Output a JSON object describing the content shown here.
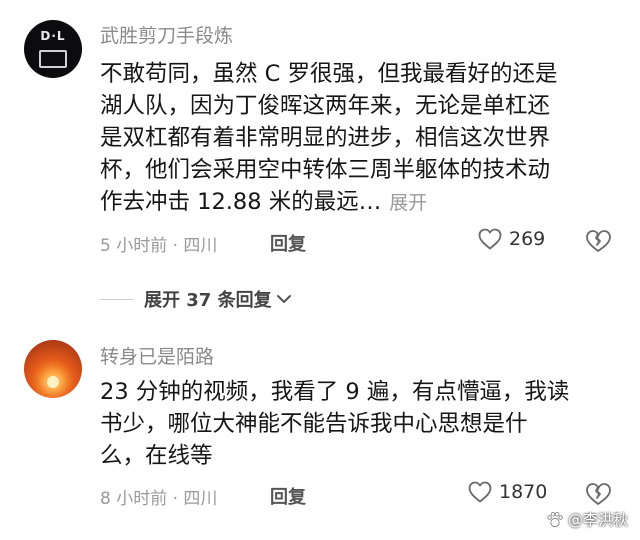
{
  "comments": [
    {
      "username": "武胜剪刀手段炼",
      "avatar_text": "D·L",
      "lines": [
        "不敢苟同，虽然 C 罗很强，但我最看好的还是",
        "湖人队，因为丁俊晖这两年来，无论是单杠还",
        "是双杠都有着非常明显的进步，相信这次世界",
        "杯，他们会采用空中转体三周半躯体的技术动",
        "作去冲击 12.88 米的最远…"
      ],
      "expand_label": "展开",
      "meta": "5 小时前 · 四川",
      "reply_label": "回复",
      "like_count": "269"
    },
    {
      "username": "转身已是陌路",
      "lines": [
        "23 分钟的视频，我看了 9 遍，有点懵逼，我读",
        "书少，哪位大神能不能告诉我中心思想是什",
        "么，在线等"
      ],
      "meta": "8 小时前 · 四川",
      "reply_label": "回复",
      "like_count": "1870"
    }
  ],
  "more_replies_label": "展开 37 条回复",
  "watermark": "@李洪秋",
  "icons": [
    "heart-outline-icon",
    "broken-heart-icon",
    "chevron-down-icon",
    "paw-logo-icon"
  ]
}
